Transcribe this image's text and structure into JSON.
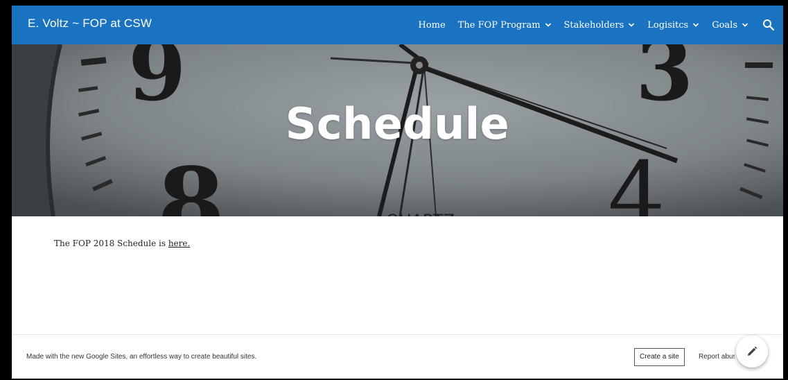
{
  "header": {
    "site_title": "E. Voltz ~ FOP at CSW",
    "nav": [
      {
        "label": "Home",
        "has_dropdown": false
      },
      {
        "label": "The FOP Program",
        "has_dropdown": true
      },
      {
        "label": "Stakeholders",
        "has_dropdown": true
      },
      {
        "label": "Logisitcs",
        "has_dropdown": true
      },
      {
        "label": "Goals",
        "has_dropdown": true
      }
    ],
    "search_icon": "search-icon"
  },
  "hero": {
    "title": "Schedule"
  },
  "content": {
    "text_before_link": "The FOP 2018 Schedule is ",
    "link_text": "here."
  },
  "footer": {
    "made_with": "Made with the new Google Sites, an effortless way to create beautiful sites.",
    "create_site_label": "Create a site",
    "report_abuse_label": "Report abuse",
    "edit_icon": "pencil-icon"
  },
  "colors": {
    "header_bg": "#1a73c0",
    "hero_bg": "#5a5f63"
  }
}
